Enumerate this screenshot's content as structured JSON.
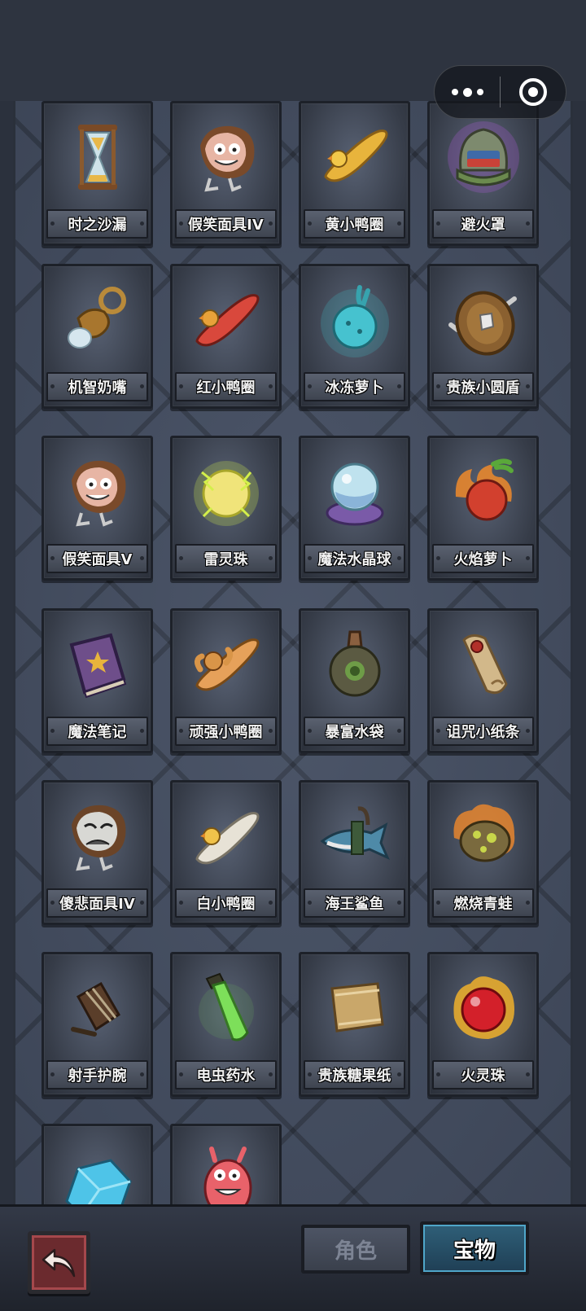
{
  "colors": {
    "panel_bg": "#454f63",
    "tab_active": "#2f5f78",
    "back_button": "#6b2a2e"
  },
  "capsule": {
    "more_icon": "more-dots-icon",
    "close_icon": "target-close-icon"
  },
  "items": [
    {
      "name": "时之沙漏",
      "icon": "hourglass-icon"
    },
    {
      "name": "假笑面具IV",
      "icon": "smile-mask-icon"
    },
    {
      "name": "黄小鸭圈",
      "icon": "yellow-duck-ring-icon"
    },
    {
      "name": "避火罩",
      "icon": "fire-helmet-icon"
    },
    {
      "name": "机智奶嘴",
      "icon": "pacifier-icon"
    },
    {
      "name": "红小鸭圈",
      "icon": "red-duck-ring-icon"
    },
    {
      "name": "冰冻萝卜",
      "icon": "frozen-radish-icon"
    },
    {
      "name": "贵族小圆盾",
      "icon": "round-shield-icon"
    },
    {
      "name": "假笑面具V",
      "icon": "smile-mask-icon"
    },
    {
      "name": "雷灵珠",
      "icon": "thunder-orb-icon"
    },
    {
      "name": "魔法水晶球",
      "icon": "crystal-ball-icon"
    },
    {
      "name": "火焰萝卜",
      "icon": "fire-radish-icon"
    },
    {
      "name": "魔法笔记",
      "icon": "magic-book-icon"
    },
    {
      "name": "顽强小鸭圈",
      "icon": "strong-duck-ring-icon"
    },
    {
      "name": "暴富水袋",
      "icon": "water-bag-icon"
    },
    {
      "name": "诅咒小纸条",
      "icon": "scroll-icon"
    },
    {
      "name": "傻悲面具IV",
      "icon": "sad-mask-icon"
    },
    {
      "name": "白小鸭圈",
      "icon": "white-duck-ring-icon"
    },
    {
      "name": "海王鲨鱼",
      "icon": "shark-icon"
    },
    {
      "name": "燃烧青蛙",
      "icon": "burning-frog-icon"
    },
    {
      "name": "射手护腕",
      "icon": "bracer-icon"
    },
    {
      "name": "电虫药水",
      "icon": "potion-icon"
    },
    {
      "name": "贵族糖果纸",
      "icon": "candy-paper-icon"
    },
    {
      "name": "火灵珠",
      "icon": "fire-orb-icon"
    },
    {
      "name": "",
      "icon": "ice-crystal-icon"
    },
    {
      "name": "",
      "icon": "pink-monster-icon"
    }
  ],
  "bottom": {
    "back_icon": "back-arrow-icon",
    "tabs": [
      {
        "label": "角色",
        "active": false
      },
      {
        "label": "宝物",
        "active": true
      }
    ]
  }
}
